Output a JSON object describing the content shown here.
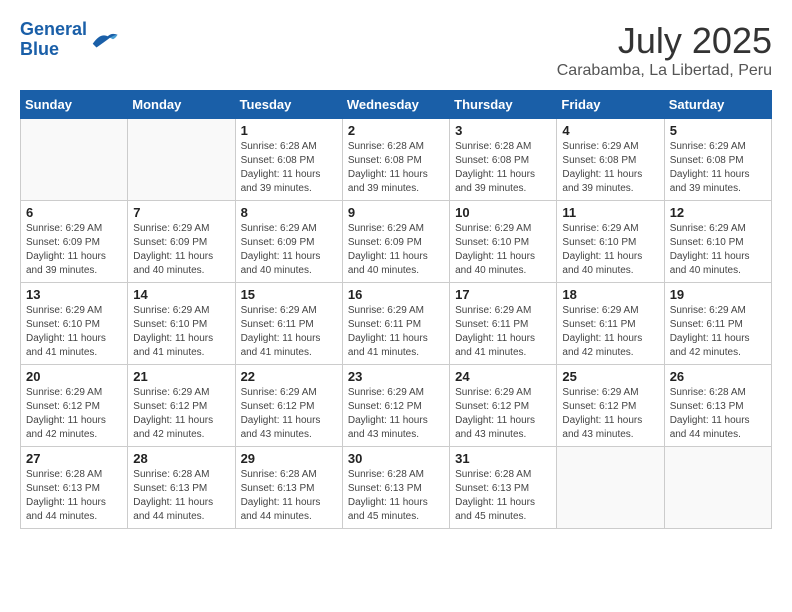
{
  "header": {
    "logo_line1": "General",
    "logo_line2": "Blue",
    "month_year": "July 2025",
    "location": "Carabamba, La Libertad, Peru"
  },
  "days_of_week": [
    "Sunday",
    "Monday",
    "Tuesday",
    "Wednesday",
    "Thursday",
    "Friday",
    "Saturday"
  ],
  "weeks": [
    [
      {
        "day": "",
        "info": ""
      },
      {
        "day": "",
        "info": ""
      },
      {
        "day": "1",
        "info": "Sunrise: 6:28 AM\nSunset: 6:08 PM\nDaylight: 11 hours and 39 minutes."
      },
      {
        "day": "2",
        "info": "Sunrise: 6:28 AM\nSunset: 6:08 PM\nDaylight: 11 hours and 39 minutes."
      },
      {
        "day": "3",
        "info": "Sunrise: 6:28 AM\nSunset: 6:08 PM\nDaylight: 11 hours and 39 minutes."
      },
      {
        "day": "4",
        "info": "Sunrise: 6:29 AM\nSunset: 6:08 PM\nDaylight: 11 hours and 39 minutes."
      },
      {
        "day": "5",
        "info": "Sunrise: 6:29 AM\nSunset: 6:08 PM\nDaylight: 11 hours and 39 minutes."
      }
    ],
    [
      {
        "day": "6",
        "info": "Sunrise: 6:29 AM\nSunset: 6:09 PM\nDaylight: 11 hours and 39 minutes."
      },
      {
        "day": "7",
        "info": "Sunrise: 6:29 AM\nSunset: 6:09 PM\nDaylight: 11 hours and 40 minutes."
      },
      {
        "day": "8",
        "info": "Sunrise: 6:29 AM\nSunset: 6:09 PM\nDaylight: 11 hours and 40 minutes."
      },
      {
        "day": "9",
        "info": "Sunrise: 6:29 AM\nSunset: 6:09 PM\nDaylight: 11 hours and 40 minutes."
      },
      {
        "day": "10",
        "info": "Sunrise: 6:29 AM\nSunset: 6:10 PM\nDaylight: 11 hours and 40 minutes."
      },
      {
        "day": "11",
        "info": "Sunrise: 6:29 AM\nSunset: 6:10 PM\nDaylight: 11 hours and 40 minutes."
      },
      {
        "day": "12",
        "info": "Sunrise: 6:29 AM\nSunset: 6:10 PM\nDaylight: 11 hours and 40 minutes."
      }
    ],
    [
      {
        "day": "13",
        "info": "Sunrise: 6:29 AM\nSunset: 6:10 PM\nDaylight: 11 hours and 41 minutes."
      },
      {
        "day": "14",
        "info": "Sunrise: 6:29 AM\nSunset: 6:10 PM\nDaylight: 11 hours and 41 minutes."
      },
      {
        "day": "15",
        "info": "Sunrise: 6:29 AM\nSunset: 6:11 PM\nDaylight: 11 hours and 41 minutes."
      },
      {
        "day": "16",
        "info": "Sunrise: 6:29 AM\nSunset: 6:11 PM\nDaylight: 11 hours and 41 minutes."
      },
      {
        "day": "17",
        "info": "Sunrise: 6:29 AM\nSunset: 6:11 PM\nDaylight: 11 hours and 41 minutes."
      },
      {
        "day": "18",
        "info": "Sunrise: 6:29 AM\nSunset: 6:11 PM\nDaylight: 11 hours and 42 minutes."
      },
      {
        "day": "19",
        "info": "Sunrise: 6:29 AM\nSunset: 6:11 PM\nDaylight: 11 hours and 42 minutes."
      }
    ],
    [
      {
        "day": "20",
        "info": "Sunrise: 6:29 AM\nSunset: 6:12 PM\nDaylight: 11 hours and 42 minutes."
      },
      {
        "day": "21",
        "info": "Sunrise: 6:29 AM\nSunset: 6:12 PM\nDaylight: 11 hours and 42 minutes."
      },
      {
        "day": "22",
        "info": "Sunrise: 6:29 AM\nSunset: 6:12 PM\nDaylight: 11 hours and 43 minutes."
      },
      {
        "day": "23",
        "info": "Sunrise: 6:29 AM\nSunset: 6:12 PM\nDaylight: 11 hours and 43 minutes."
      },
      {
        "day": "24",
        "info": "Sunrise: 6:29 AM\nSunset: 6:12 PM\nDaylight: 11 hours and 43 minutes."
      },
      {
        "day": "25",
        "info": "Sunrise: 6:29 AM\nSunset: 6:12 PM\nDaylight: 11 hours and 43 minutes."
      },
      {
        "day": "26",
        "info": "Sunrise: 6:28 AM\nSunset: 6:13 PM\nDaylight: 11 hours and 44 minutes."
      }
    ],
    [
      {
        "day": "27",
        "info": "Sunrise: 6:28 AM\nSunset: 6:13 PM\nDaylight: 11 hours and 44 minutes."
      },
      {
        "day": "28",
        "info": "Sunrise: 6:28 AM\nSunset: 6:13 PM\nDaylight: 11 hours and 44 minutes."
      },
      {
        "day": "29",
        "info": "Sunrise: 6:28 AM\nSunset: 6:13 PM\nDaylight: 11 hours and 44 minutes."
      },
      {
        "day": "30",
        "info": "Sunrise: 6:28 AM\nSunset: 6:13 PM\nDaylight: 11 hours and 45 minutes."
      },
      {
        "day": "31",
        "info": "Sunrise: 6:28 AM\nSunset: 6:13 PM\nDaylight: 11 hours and 45 minutes."
      },
      {
        "day": "",
        "info": ""
      },
      {
        "day": "",
        "info": ""
      }
    ]
  ]
}
